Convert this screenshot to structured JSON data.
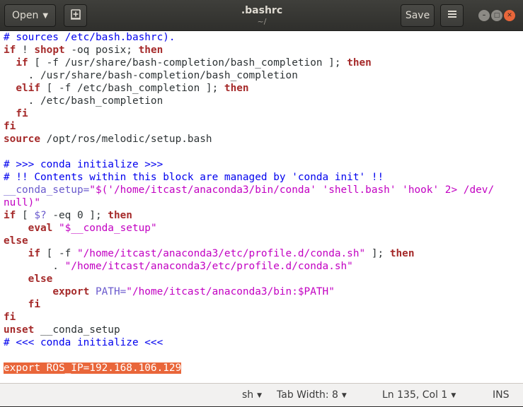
{
  "header": {
    "open_label": "Open",
    "save_label": "Save",
    "title": ".bashrc",
    "subtitle": "~/"
  },
  "editor": {
    "lines": [
      [
        {
          "t": "# sources /etc/bash.bashrc).",
          "c": "cmt"
        }
      ],
      [
        {
          "t": "if",
          "c": "kw"
        },
        {
          "t": " ! "
        },
        {
          "t": "shopt",
          "c": "kw"
        },
        {
          "t": " -oq posix; "
        },
        {
          "t": "then",
          "c": "kw"
        }
      ],
      [
        {
          "t": "  "
        },
        {
          "t": "if",
          "c": "kw"
        },
        {
          "t": " [ -f /usr/share/bash-completion/bash_completion ]; "
        },
        {
          "t": "then",
          "c": "kw"
        }
      ],
      [
        {
          "t": "    . /usr/share/bash-completion/bash_completion"
        }
      ],
      [
        {
          "t": "  "
        },
        {
          "t": "elif",
          "c": "kw"
        },
        {
          "t": " [ -f /etc/bash_completion ]; "
        },
        {
          "t": "then",
          "c": "kw"
        }
      ],
      [
        {
          "t": "    . /etc/bash_completion"
        }
      ],
      [
        {
          "t": "  "
        },
        {
          "t": "fi",
          "c": "kw"
        }
      ],
      [
        {
          "t": "fi",
          "c": "kw"
        }
      ],
      [
        {
          "t": "source",
          "c": "kw"
        },
        {
          "t": " /opt/ros/melodic/setup.bash"
        }
      ],
      [
        {
          "t": ""
        }
      ],
      [
        {
          "t": "# >>> conda initialize >>>",
          "c": "cmt"
        }
      ],
      [
        {
          "t": "# !! Contents within this block are managed by 'conda init' !!",
          "c": "cmt"
        }
      ],
      [
        {
          "t": "__conda_setup=",
          "c": "var"
        },
        {
          "t": "\"$('/home/itcast/anaconda3/bin/conda' 'shell.bash' 'hook' 2> /dev/",
          "c": "str"
        }
      ],
      [
        {
          "t": "null)\"",
          "c": "str"
        }
      ],
      [
        {
          "t": "if",
          "c": "kw"
        },
        {
          "t": " [ "
        },
        {
          "t": "$?",
          "c": "var"
        },
        {
          "t": " -eq 0 ]; "
        },
        {
          "t": "then",
          "c": "kw"
        }
      ],
      [
        {
          "t": "    "
        },
        {
          "t": "eval",
          "c": "kw"
        },
        {
          "t": " "
        },
        {
          "t": "\"$__conda_setup\"",
          "c": "str"
        }
      ],
      [
        {
          "t": "else",
          "c": "kw"
        }
      ],
      [
        {
          "t": "    "
        },
        {
          "t": "if",
          "c": "kw"
        },
        {
          "t": " [ -f "
        },
        {
          "t": "\"/home/itcast/anaconda3/etc/profile.d/conda.sh\"",
          "c": "str"
        },
        {
          "t": " ]; "
        },
        {
          "t": "then",
          "c": "kw"
        }
      ],
      [
        {
          "t": "        . "
        },
        {
          "t": "\"/home/itcast/anaconda3/etc/profile.d/conda.sh\"",
          "c": "str"
        }
      ],
      [
        {
          "t": "    "
        },
        {
          "t": "else",
          "c": "kw"
        }
      ],
      [
        {
          "t": "        "
        },
        {
          "t": "export",
          "c": "kw"
        },
        {
          "t": " "
        },
        {
          "t": "PATH=",
          "c": "var"
        },
        {
          "t": "\"/home/itcast/anaconda3/bin:$PATH\"",
          "c": "str"
        }
      ],
      [
        {
          "t": "    "
        },
        {
          "t": "fi",
          "c": "kw"
        }
      ],
      [
        {
          "t": "fi",
          "c": "kw"
        }
      ],
      [
        {
          "t": "unset",
          "c": "kw"
        },
        {
          "t": " __conda_setup"
        }
      ],
      [
        {
          "t": "# <<< conda initialize <<<",
          "c": "cmt"
        }
      ],
      [
        {
          "t": ""
        }
      ],
      [
        {
          "t": "export ROS_IP=192.168.106.129",
          "c": "sel"
        }
      ]
    ]
  },
  "statusbar": {
    "language": "sh",
    "tab_width": "Tab Width: 8",
    "position": "Ln 135, Col 1",
    "mode": "INS"
  },
  "colors": {
    "keyword": "#a52a2a",
    "string": "#c200c2",
    "variable": "#6a5acd",
    "comment": "#0000ee",
    "selection": "#e9663a"
  }
}
